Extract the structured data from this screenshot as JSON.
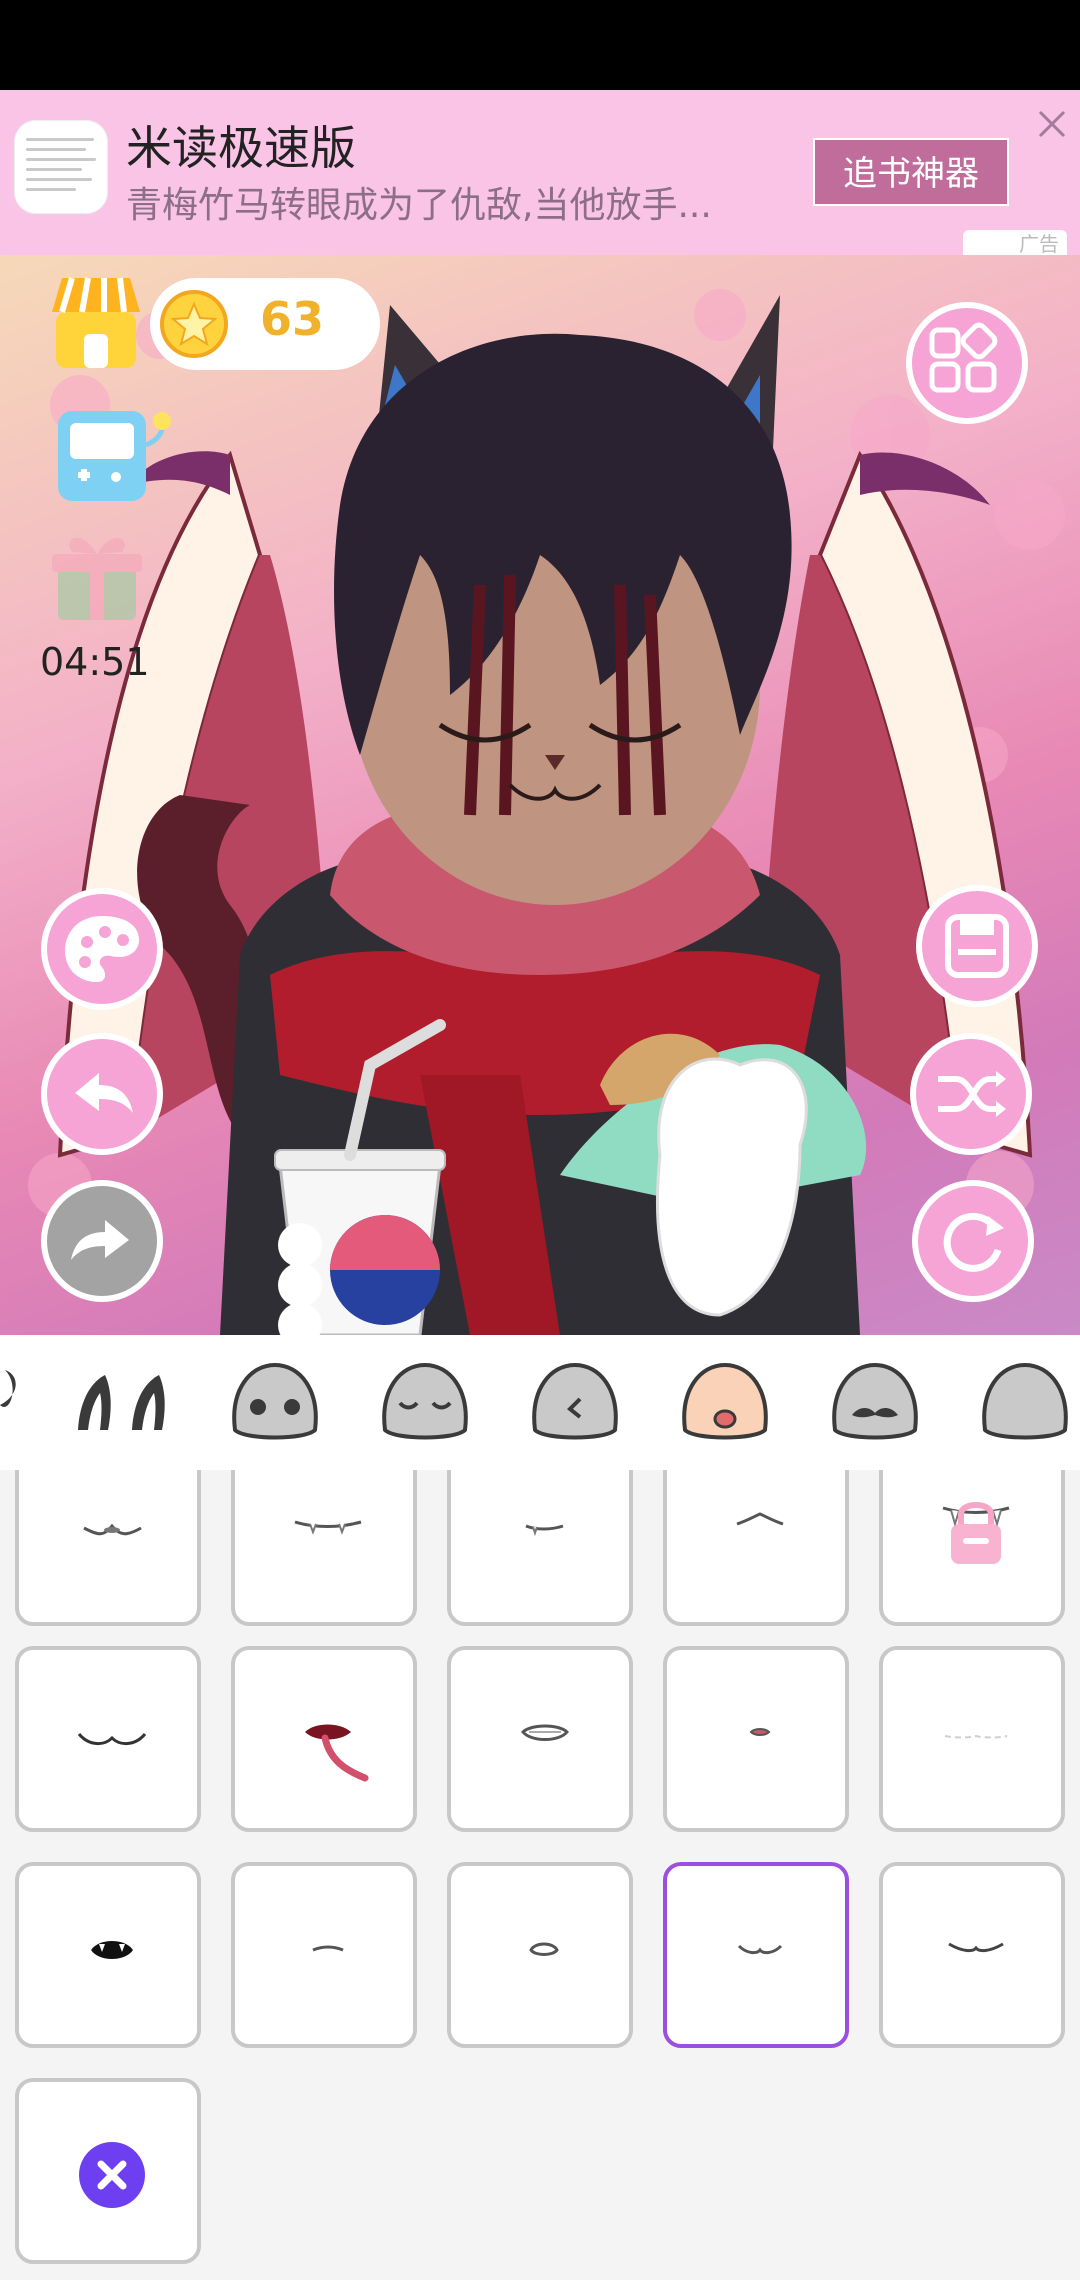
{
  "ad": {
    "app_name": "米读极速版",
    "description": "青梅竹马转眼成为了仇敌,当他放手...",
    "cta_label": "追书神器",
    "badge": "广告",
    "close_icon": "close-icon",
    "thumbnail_icon": "book-thumbnail-icon"
  },
  "hud": {
    "coins": "63",
    "timer": "04:51",
    "shop_icon": "shop-icon",
    "minigame_icon": "game-console-icon",
    "gift_icon": "gift-icon"
  },
  "left_tools": [
    "palette-icon",
    "undo-icon",
    "redo-icon"
  ],
  "right_tools": [
    "menu-grid-icon",
    "save-icon",
    "shuffle-icon",
    "reset-icon"
  ],
  "categories": [
    {
      "name": "hair",
      "icon": "hair-icon"
    },
    {
      "name": "ears",
      "icon": "ears-icon"
    },
    {
      "name": "eyes",
      "icon": "eyes-face-icon"
    },
    {
      "name": "eyebrows",
      "icon": "closed-eyes-face-icon"
    },
    {
      "name": "nose",
      "icon": "nose-face-icon"
    },
    {
      "name": "mouth",
      "icon": "mouth-face-icon",
      "selected": true
    },
    {
      "name": "mustache",
      "icon": "mustache-face-icon"
    },
    {
      "name": "more",
      "icon": "face-icon"
    }
  ],
  "mouth_options": [
    {
      "icon": "smile-mouth-icon"
    },
    {
      "icon": "fanged-mouth-icon"
    },
    {
      "icon": "small-fang-mouth-icon"
    },
    {
      "icon": "pointed-mouth-icon"
    },
    {
      "icon": "fang-mouth-icon",
      "locked": true
    },
    {
      "icon": "wavy-smile-mouth-icon"
    },
    {
      "icon": "tongue-mouth-icon"
    },
    {
      "icon": "grin-mouth-icon"
    },
    {
      "icon": "tiny-lips-icon"
    },
    {
      "icon": "faint-mouth-icon"
    },
    {
      "icon": "open-fangs-mouth-icon"
    },
    {
      "icon": "line-mouth-icon"
    },
    {
      "icon": "oval-mouth-icon"
    },
    {
      "icon": "gentle-smile-mouth-icon",
      "selected": true
    },
    {
      "icon": "wide-smile-mouth-icon"
    },
    {
      "icon": "remove-icon"
    }
  ],
  "colors": {
    "ad_bg": "#f9c4e6",
    "accent_pink": "#f6a3d6",
    "coin": "#f0b12c",
    "selected_border": "#9b4fe0",
    "remove_button": "#6d3ff0"
  }
}
